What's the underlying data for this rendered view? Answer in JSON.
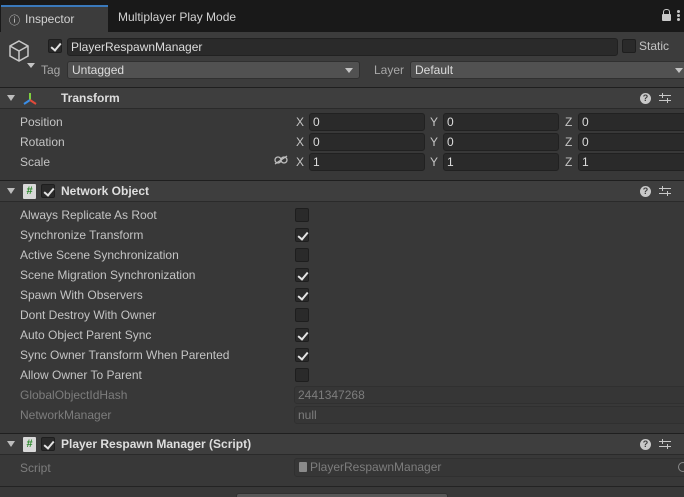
{
  "tabs": {
    "inspector": "Inspector",
    "multiplayer": "Multiplayer Play Mode"
  },
  "header": {
    "object_name": "PlayerRespawnManager",
    "active": true,
    "static_label": "Static",
    "static": false,
    "tag_label": "Tag",
    "tag_value": "Untagged",
    "layer_label": "Layer",
    "layer_value": "Default"
  },
  "transform": {
    "title": "Transform",
    "position_label": "Position",
    "rotation_label": "Rotation",
    "scale_label": "Scale",
    "axis_x": "X",
    "axis_y": "Y",
    "axis_z": "Z",
    "position": {
      "x": "0",
      "y": "0",
      "z": "0"
    },
    "rotation": {
      "x": "0",
      "y": "0",
      "z": "0"
    },
    "scale": {
      "x": "1",
      "y": "1",
      "z": "1"
    }
  },
  "network_object": {
    "title": "Network Object",
    "enabled": true,
    "properties": [
      {
        "label": "Always Replicate As Root",
        "checked": false
      },
      {
        "label": "Synchronize Transform",
        "checked": true
      },
      {
        "label": "Active Scene Synchronization",
        "checked": false
      },
      {
        "label": "Scene Migration Synchronization",
        "checked": true
      },
      {
        "label": "Spawn With Observers",
        "checked": true
      },
      {
        "label": "Dont Destroy With Owner",
        "checked": false
      },
      {
        "label": "Auto Object Parent Sync",
        "checked": true
      },
      {
        "label": "Sync Owner Transform When Parented",
        "checked": true
      },
      {
        "label": "Allow Owner To Parent",
        "checked": false
      }
    ],
    "global_hash_label": "GlobalObjectIdHash",
    "global_hash_value": "2441347268",
    "network_manager_label": "NetworkManager",
    "network_manager_value": "null"
  },
  "script_component": {
    "title": "Player Respawn Manager (Script)",
    "enabled": true,
    "script_label": "Script",
    "script_value": "PlayerRespawnManager"
  },
  "colors": {
    "tab_accent": "#3a79bb",
    "panel_bg": "#383838",
    "field_bg": "#2a2a2a"
  }
}
